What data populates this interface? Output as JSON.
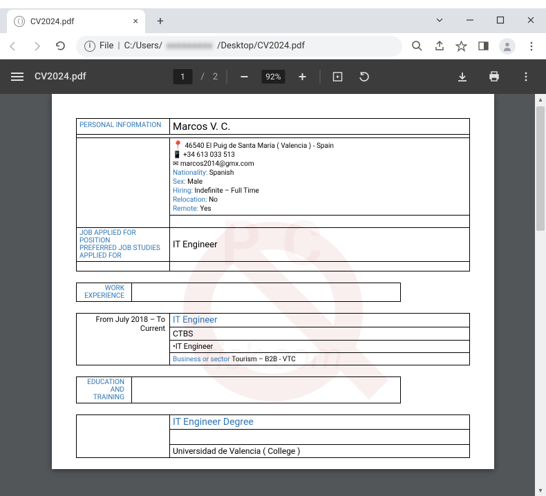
{
  "tab": {
    "title": "CV2024.pdf"
  },
  "address": {
    "file_label": "File",
    "path_prefix": "C:/Users/",
    "path_blur": "xxxxxxxxx",
    "path_suffix": "/Desktop/CV2024.pdf"
  },
  "pdf_toolbar": {
    "filename": "CV2024.pdf",
    "page_current": "1",
    "page_sep": "/",
    "page_total": "2",
    "zoom": "92%"
  },
  "cv": {
    "personal_info_label": "PERSONAL INFORMATION",
    "name": "Marcos V. C.",
    "address": "46540 El Puig de Santa María ( Valencia ) - Spain",
    "phone": "+34 613 033 513",
    "email": "marcos2014@gmx.com",
    "nationality_label": "Nationality:",
    "nationality": "Spanish",
    "sex_label": "Sex:",
    "sex": "Male",
    "hiring_label": "Hiring:",
    "hiring": "Indefinite  – Full Time",
    "relocation_label": "Relocation:",
    "relocation": "No",
    "remote_label": "Remote:",
    "remote": "Yes",
    "job_applied_label": "JOB APPLIED FOR POSITION",
    "preferred_label": "PREFERRED JOB STUDIES APPLIED FOR",
    "job_title": "IT Engineer",
    "work_exp_label": "WORK EXPERIENCE",
    "exp_period": "From July 2018 – To Current",
    "exp_title": "IT  Engineer",
    "exp_company": "CTBS",
    "exp_role": "•IT Engineer",
    "exp_sector_label": "Business or sector",
    "exp_sector": "Tourism – B2B - VTC",
    "edu_label": "EDUCATION AND TRAINING",
    "degree": "IT Engineer Degree",
    "university": "Universidad de Valencia ( College )"
  }
}
